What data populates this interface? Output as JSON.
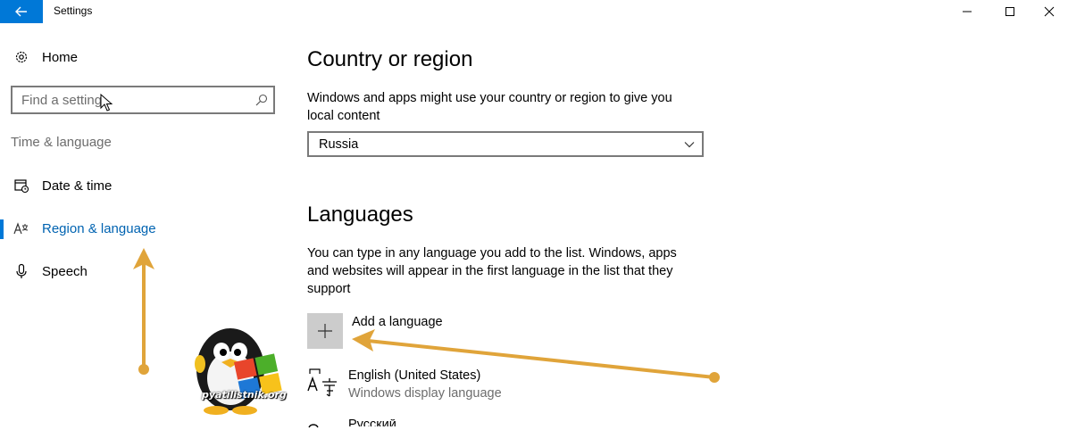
{
  "window": {
    "title": "Settings",
    "controls": {
      "minimize": "minimize-icon",
      "maximize": "maximize-icon",
      "close": "close-icon"
    }
  },
  "sidebar": {
    "home_label": "Home",
    "search_placeholder": "Find a setting",
    "section_label": "Time & language",
    "items": [
      {
        "label": "Date & time",
        "icon": "calendar-clock-icon",
        "active": false
      },
      {
        "label": "Region & language",
        "icon": "region-language-icon",
        "active": true
      },
      {
        "label": "Speech",
        "icon": "microphone-icon",
        "active": false
      }
    ]
  },
  "main": {
    "country": {
      "heading": "Country or region",
      "description": "Windows and apps might use your country or region to give you local content",
      "selected": "Russia"
    },
    "languages": {
      "heading": "Languages",
      "description": "You can type in any language you add to the list. Windows, apps and websites will appear in the first language in the list that they support",
      "add_label": "Add a language",
      "list": [
        {
          "name": "English (United States)",
          "sub": "Windows display language"
        },
        {
          "name": "Русский",
          "sub": ""
        }
      ]
    }
  },
  "watermark": {
    "text": "pyatilistnik.org"
  },
  "colors": {
    "accent": "#0078d7",
    "arrow": "#e0a43a"
  }
}
